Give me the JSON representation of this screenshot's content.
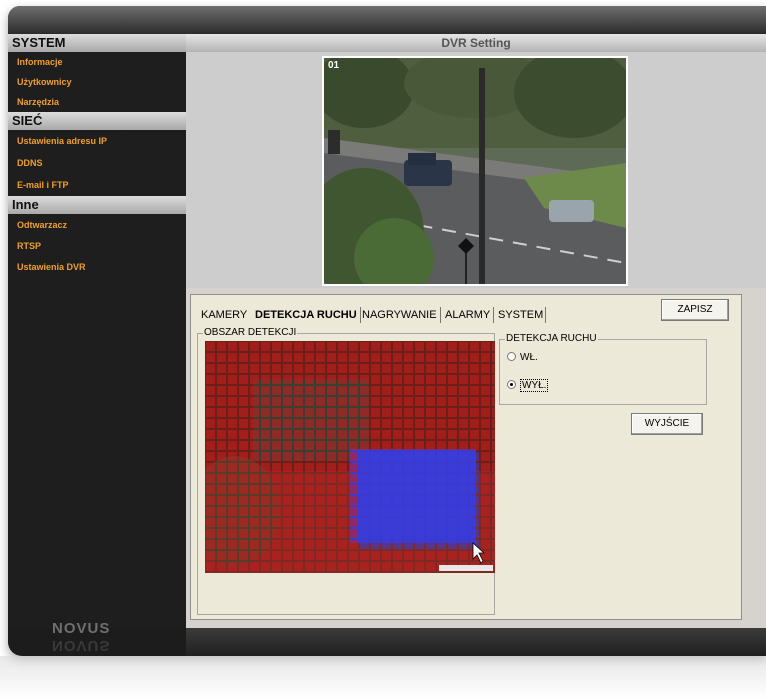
{
  "app": {
    "title": "DVR Setting",
    "logo": "NOVUS"
  },
  "sidebar": {
    "sections": [
      {
        "label": "SYSTEM",
        "items": [
          "Informacje",
          "Użytkownicy",
          "Narzędzia"
        ]
      },
      {
        "label": "SIEĆ",
        "items": [
          "Ustawienia adresu IP",
          "DDNS",
          "E-mail i FTP"
        ]
      },
      {
        "label": "Inne",
        "items": [
          "Odtwarzacz",
          "RTSP",
          "Ustawienia DVR"
        ]
      }
    ]
  },
  "camera": {
    "number": "01"
  },
  "tabs": [
    "KAMERY",
    "DETEKCJA RUCHU",
    "NAGRYWANIE",
    "ALARMY",
    "SYSTEM"
  ],
  "active_tab": "DETEKCJA RUCHU",
  "buttons": {
    "save": "ZAPISZ",
    "exit": "WYJŚCIE"
  },
  "detection_area": {
    "label": "OBSZAR DETEKCJI",
    "grid_color": "#c81e1e",
    "selection_color": "#3c3cdc"
  },
  "motion_detection": {
    "label": "DETEKCJA RUCHU",
    "options": [
      "WŁ.",
      "WYŁ."
    ],
    "selected": "WYŁ."
  },
  "colors": {
    "nav_text": "#f0a020",
    "section_header": "#c0c0c0",
    "panel_bg": "#ece9d8"
  },
  "icons": {
    "cursor": "mouse-pointer-icon"
  }
}
